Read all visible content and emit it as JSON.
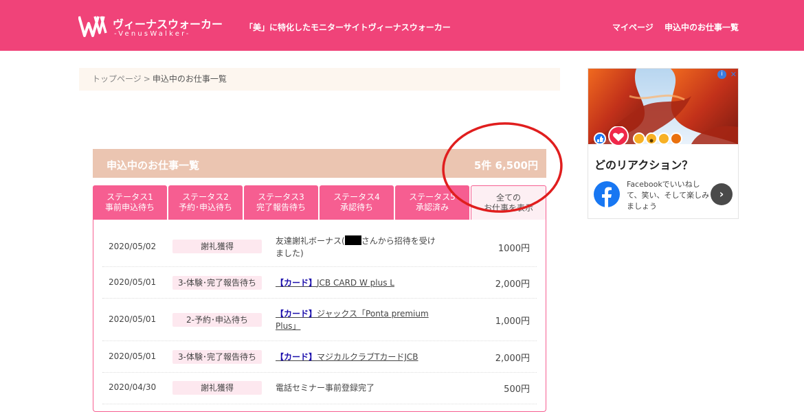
{
  "header": {
    "logo_jp": "ヴィーナスウォーカー",
    "logo_en": "-VenusWalker-",
    "tagline": "「美」に特化したモニターサイトヴィーナスウォーカー",
    "nav": [
      "マイページ",
      "申込中のお仕事一覧"
    ]
  },
  "breadcrumb": {
    "home": "トップページ",
    "separator": ">",
    "current": "申込中のお仕事一覧"
  },
  "summary": {
    "title": "申込中のお仕事一覧",
    "total": "5件 6,500円"
  },
  "tabs": [
    {
      "line1": "ステータス1",
      "line2": "事前申込待ち"
    },
    {
      "line1": "ステータス2",
      "line2": "予約･申込待ち"
    },
    {
      "line1": "ステータス3",
      "line2": "完了報告待ち"
    },
    {
      "line1": "ステータス4",
      "line2": "承認待ち"
    },
    {
      "line1": "ステータス5",
      "line2": "承認済み"
    },
    {
      "line1": "全ての",
      "line2": "お仕事を表示"
    }
  ],
  "jobs": [
    {
      "date": "2020/05/02",
      "status": "謝礼獲得",
      "title_pre": "友達謝礼ボーナス(",
      "title_post": "さんから招待を受けました)",
      "amount": "1000円"
    },
    {
      "date": "2020/05/01",
      "status": "3-体験･完了報告待ち",
      "category": "【カード】",
      "title": "JCB CARD W plus L",
      "amount": "2,000円"
    },
    {
      "date": "2020/05/01",
      "status": "2-予約･申込待ち",
      "category": "【カード】",
      "title": "ジャックス「Ponta premium Plus」",
      "amount": "1,000円"
    },
    {
      "date": "2020/05/01",
      "status": "3-体験･完了報告待ち",
      "category": "【カード】",
      "title": "マジカルクラブTカードJCB",
      "amount": "2,000円"
    },
    {
      "date": "2020/04/30",
      "status": "謝礼獲得",
      "title": "電話セミナー事前登録完了",
      "amount": "500円"
    }
  ],
  "ad": {
    "close": "✕",
    "info": "i",
    "headline": "どのリアクション？",
    "text": "Facebookでいいねして、笑い、そして楽しみましょう",
    "next": "›"
  },
  "colors": {
    "header": "#f04379",
    "tab": "#f65e91",
    "summary": "#ebc5b1",
    "annotation": "#e01e1e",
    "facebook": "#1877f2"
  }
}
